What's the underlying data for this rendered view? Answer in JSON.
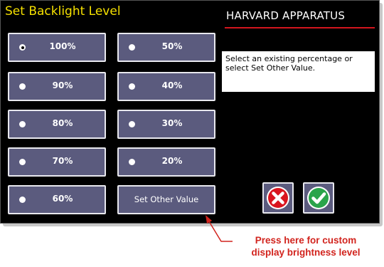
{
  "header": {
    "title": "Set Backlight Level",
    "brand": "HARVARD APPARATUS"
  },
  "options": [
    {
      "label": "100%",
      "selected": true
    },
    {
      "label": "90%",
      "selected": false
    },
    {
      "label": "80%",
      "selected": false
    },
    {
      "label": "70%",
      "selected": false
    },
    {
      "label": "60%",
      "selected": false
    },
    {
      "label": "50%",
      "selected": false
    },
    {
      "label": "40%",
      "selected": false
    },
    {
      "label": "30%",
      "selected": false
    },
    {
      "label": "20%",
      "selected": false
    }
  ],
  "other_button": {
    "label": "Set Other Value"
  },
  "info": {
    "text": "Select an existing percentage or select Set Other Value."
  },
  "actions": {
    "cancel_icon": "close-circle-icon",
    "confirm_icon": "check-circle-icon"
  },
  "annotation": {
    "line1": "Press here for custom",
    "line2": "display brightness level"
  },
  "colors": {
    "title": "#f5e000",
    "button_fill": "#5b5b7e",
    "brand_rule": "#d2161e",
    "annotation": "#d2241e",
    "cancel": "#d9151f",
    "confirm": "#2aa44a"
  }
}
